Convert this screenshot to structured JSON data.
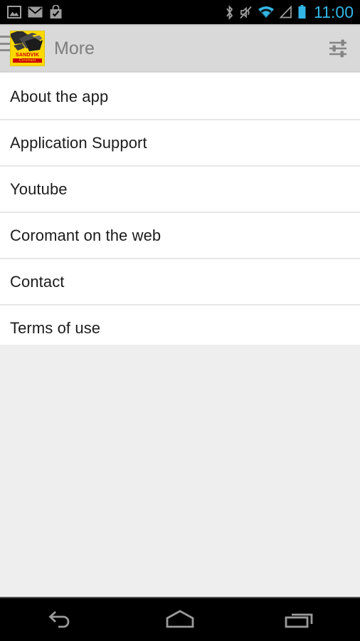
{
  "status_bar": {
    "notification_icons": [
      {
        "name": "gallery-icon",
        "label": "Screenshot captured"
      },
      {
        "name": "mail-icon",
        "label": "New email"
      },
      {
        "name": "play-store-icon",
        "label": "App installed"
      }
    ],
    "system_icons": [
      {
        "name": "bluetooth-icon",
        "label": "Bluetooth on"
      },
      {
        "name": "mute-icon",
        "label": "Sound muted"
      },
      {
        "name": "wifi-icon",
        "label": "Wi-Fi connected"
      },
      {
        "name": "cell-signal-icon",
        "label": "No SIM"
      },
      {
        "name": "battery-icon",
        "label": "Battery full"
      }
    ],
    "clock": "11:00",
    "accent_color": "#33b5e5",
    "background_color": "#000000",
    "icon_color": "#9e9e9e"
  },
  "action_bar": {
    "drawer_icon": "hamburger-menu-icon",
    "logo": {
      "name": "sandvik-coromant-logo",
      "brand_line1": "SANDVIK",
      "brand_line2": "Coromant",
      "background_color": "#ffd900",
      "text_color": "#cc0000"
    },
    "title": "More",
    "title_color": "#7d7d7d",
    "background_color": "#d9d9d9",
    "settings_icon": "sliders-settings-icon"
  },
  "list": {
    "items": [
      {
        "label": "About the app"
      },
      {
        "label": "Application Support"
      },
      {
        "label": "Youtube"
      },
      {
        "label": "Coromant on the web"
      },
      {
        "label": "Contact"
      },
      {
        "label": "Terms of use"
      }
    ],
    "background_color": "#ffffff",
    "divider_color": "#e7e7e7",
    "text_color": "#1c1c1c",
    "empty_area_color": "#eeeeee"
  },
  "nav_bar": {
    "buttons": [
      {
        "name": "back-button",
        "label": "Back"
      },
      {
        "name": "home-button",
        "label": "Home"
      },
      {
        "name": "recents-button",
        "label": "Recent apps"
      }
    ],
    "background_color": "#000000",
    "icon_color": "#9a9a9a"
  }
}
